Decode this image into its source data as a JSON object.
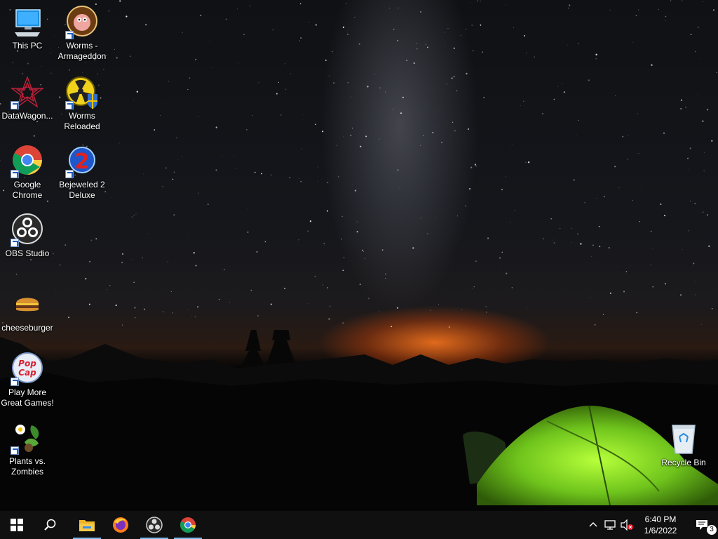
{
  "desktop_icons": [
    {
      "id": "this-pc",
      "label": "This PC"
    },
    {
      "id": "worms-armageddon",
      "label": "Worms -\nArmageddon"
    },
    {
      "id": "datawagon",
      "label": "DataWagon..."
    },
    {
      "id": "worms-reloaded",
      "label": "Worms\nReloaded"
    },
    {
      "id": "google-chrome",
      "label": "Google\nChrome"
    },
    {
      "id": "bejeweled-2",
      "label": "Bejeweled 2\nDeluxe"
    },
    {
      "id": "obs-studio",
      "label": "OBS Studio"
    },
    {
      "id": "cheeseburger",
      "label": "cheeseburger"
    },
    {
      "id": "play-more-games",
      "label": "Play More\nGreat Games!"
    },
    {
      "id": "plants-vs-zombies",
      "label": "Plants vs.\nZombies"
    },
    {
      "id": "recycle-bin",
      "label": "Recycle Bin"
    }
  ],
  "taskbar": {
    "apps": [
      "Start",
      "Search",
      "File Explorer",
      "Firefox",
      "OBS Studio",
      "Google Chrome"
    ],
    "clock": {
      "time": "6:40 PM",
      "date": "1/6/2022"
    },
    "notification_count": "3"
  },
  "colors": {
    "taskbar": "#101010",
    "active_indicator": "#76b9ed",
    "tent": "#8ee02a"
  }
}
